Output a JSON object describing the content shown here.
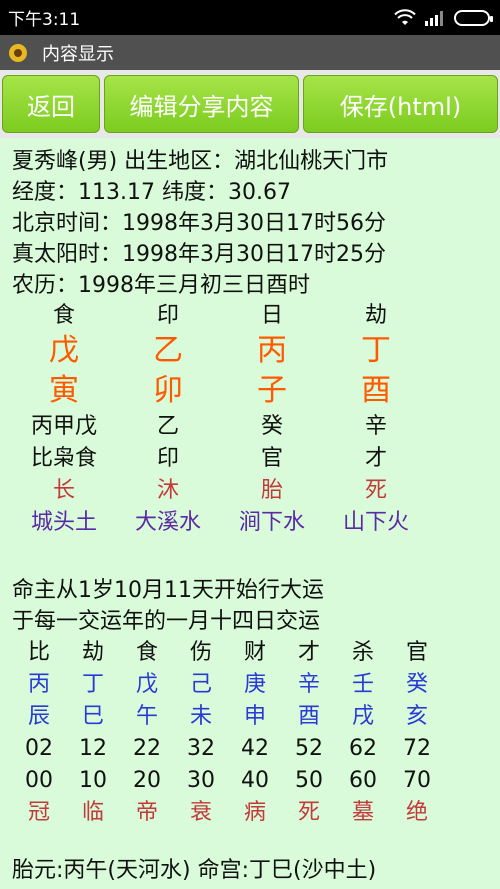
{
  "status_bar": {
    "time": "下午3:11"
  },
  "title_bar": {
    "title": "内容显示"
  },
  "toolbar": {
    "back_label": "返回",
    "edit_share_label": "编辑分享内容",
    "save_label": "保存(html)"
  },
  "info": {
    "line1": "夏秀峰(男) 出生地区：湖北仙桃天门市",
    "line2": "经度：113.17 纬度：30.67",
    "line3": "北京时间：1998年3月30日17时56分",
    "line4": "真太阳时：1998年3月30日17时25分",
    "line5": "农历：1998年三月初三日酉时"
  },
  "pillars": [
    {
      "god": "食",
      "stem": "戊",
      "branch": "寅",
      "hidden": "丙甲戊",
      "hidden_gods": "比枭食",
      "stage": "长",
      "nayin": "城头土"
    },
    {
      "god": "印",
      "stem": "乙",
      "branch": "卯",
      "hidden": "乙",
      "hidden_gods": "印",
      "stage": "沐",
      "nayin": "大溪水"
    },
    {
      "god": "日",
      "stem": "丙",
      "branch": "子",
      "hidden": "癸",
      "hidden_gods": "官",
      "stage": "胎",
      "nayin": "涧下水"
    },
    {
      "god": "劫",
      "stem": "丁",
      "branch": "酉",
      "hidden": "辛",
      "hidden_gods": "才",
      "stage": "死",
      "nayin": "山下火"
    }
  ],
  "dayun_intro": {
    "line1": "命主从1岁10月11天开始行大运",
    "line2": "于每一交运年的一月十四日交运"
  },
  "dayun": [
    {
      "god": "比",
      "stem": "丙",
      "branch": "辰",
      "age": "02",
      "year": "00",
      "stage": "冠"
    },
    {
      "god": "劫",
      "stem": "丁",
      "branch": "巳",
      "age": "12",
      "year": "10",
      "stage": "临"
    },
    {
      "god": "食",
      "stem": "戊",
      "branch": "午",
      "age": "22",
      "year": "20",
      "stage": "帝"
    },
    {
      "god": "伤",
      "stem": "己",
      "branch": "未",
      "age": "32",
      "year": "30",
      "stage": "衰"
    },
    {
      "god": "财",
      "stem": "庚",
      "branch": "申",
      "age": "42",
      "year": "40",
      "stage": "病"
    },
    {
      "god": "才",
      "stem": "辛",
      "branch": "酉",
      "age": "52",
      "year": "50",
      "stage": "死"
    },
    {
      "god": "杀",
      "stem": "壬",
      "branch": "戌",
      "age": "62",
      "year": "60",
      "stage": "墓"
    },
    {
      "god": "官",
      "stem": "癸",
      "branch": "亥",
      "age": "72",
      "year": "70",
      "stage": "绝"
    }
  ],
  "bottom": {
    "line": "胎元:丙午(天河水) 命宫:丁巳(沙中土)"
  }
}
